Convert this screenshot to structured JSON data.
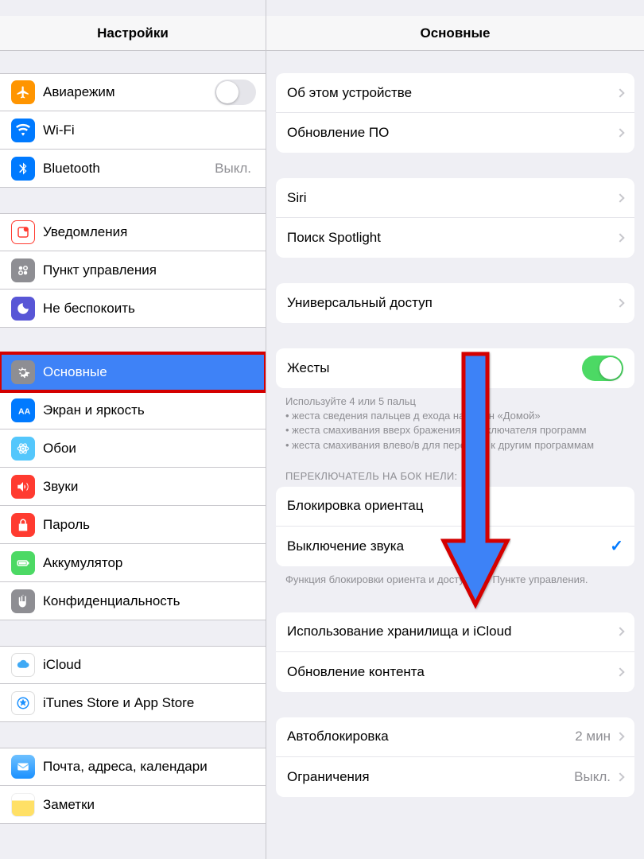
{
  "sidebar": {
    "title": "Настройки",
    "groups": [
      {
        "items": [
          {
            "id": "airplane",
            "label": "Авиарежим",
            "type": "toggle",
            "toggle": false
          },
          {
            "id": "wifi",
            "label": "Wi-Fi",
            "type": "nav"
          },
          {
            "id": "bluetooth",
            "label": "Bluetooth",
            "type": "nav",
            "value": "Выкл."
          }
        ]
      },
      {
        "items": [
          {
            "id": "notifications",
            "label": "Уведомления",
            "type": "nav"
          },
          {
            "id": "controlcenter",
            "label": "Пункт управления",
            "type": "nav"
          },
          {
            "id": "dnd",
            "label": "Не беспокоить",
            "type": "nav"
          }
        ]
      },
      {
        "items": [
          {
            "id": "general",
            "label": "Основные",
            "type": "nav",
            "selected": true,
            "highlight": true
          },
          {
            "id": "display",
            "label": "Экран и яркость",
            "type": "nav"
          },
          {
            "id": "wallpaper",
            "label": "Обои",
            "type": "nav"
          },
          {
            "id": "sounds",
            "label": "Звуки",
            "type": "nav"
          },
          {
            "id": "passcode",
            "label": "Пароль",
            "type": "nav"
          },
          {
            "id": "battery",
            "label": "Аккумулятор",
            "type": "nav"
          },
          {
            "id": "privacy",
            "label": "Конфиденциальность",
            "type": "nav"
          }
        ]
      },
      {
        "items": [
          {
            "id": "icloud",
            "label": "iCloud",
            "type": "nav"
          },
          {
            "id": "appstore",
            "label": "iTunes Store и App Store",
            "type": "nav"
          }
        ]
      },
      {
        "items": [
          {
            "id": "mail",
            "label": "Почта, адреса, календари",
            "type": "nav"
          },
          {
            "id": "notes",
            "label": "Заметки",
            "type": "nav"
          }
        ]
      }
    ]
  },
  "detail": {
    "title": "Основные",
    "groups": [
      {
        "items": [
          {
            "id": "about",
            "label": "Об этом устройстве",
            "chevron": true
          },
          {
            "id": "update",
            "label": "Обновление ПО",
            "chevron": true
          }
        ]
      },
      {
        "items": [
          {
            "id": "siri",
            "label": "Siri",
            "chevron": true
          },
          {
            "id": "spotlight",
            "label": "Поиск Spotlight",
            "chevron": true
          }
        ]
      },
      {
        "items": [
          {
            "id": "accessibility",
            "label": "Универсальный доступ",
            "chevron": true
          }
        ]
      },
      {
        "items": [
          {
            "id": "gestures",
            "label": "Жесты",
            "toggle": true
          }
        ],
        "footer_lines": [
          "Используйте 4 или 5 пальц",
          "• жеста сведения пальцев д             ехода на экран «Домой»",
          "• жеста смахивания вверх             бражения переключателя программ",
          "• жеста смахивания влево/в            для перехода к другим программам"
        ]
      },
      {
        "header": "ПЕРЕКЛЮЧАТЕЛЬ НА БОК                НЕЛИ:",
        "items": [
          {
            "id": "orientlock",
            "label": "Блокировка ориентац"
          },
          {
            "id": "mute",
            "label": "Выключение звука",
            "checked": true
          }
        ],
        "footer": "Функция блокировки ориента      и доступна в Пункте управления."
      },
      {
        "items": [
          {
            "id": "storage",
            "label": "Использование хранилища и iCloud",
            "chevron": true
          },
          {
            "id": "bgrefresh",
            "label": "Обновление контента",
            "chevron": true
          }
        ]
      },
      {
        "items": [
          {
            "id": "autolock",
            "label": "Автоблокировка",
            "value": "2 мин",
            "chevron": true
          },
          {
            "id": "restrict",
            "label": "Ограничения",
            "value": "Выкл.",
            "chevron": true
          }
        ]
      }
    ]
  }
}
